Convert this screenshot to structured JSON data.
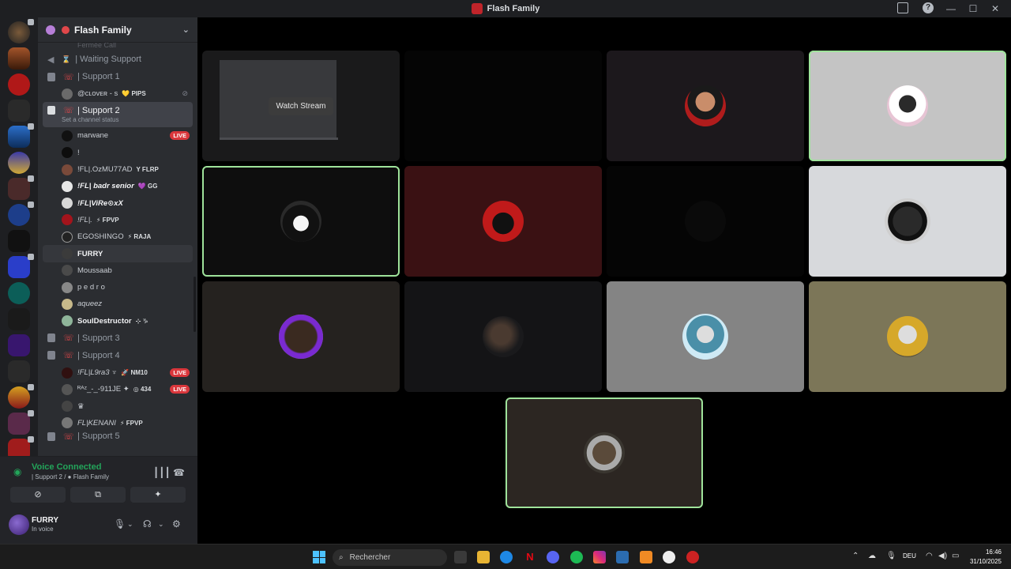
{
  "window": {
    "title": "Flash Family",
    "help_icon": "?",
    "controls": [
      "—",
      "☐",
      "✕"
    ]
  },
  "server": {
    "name": "Flash Family",
    "header_glyph": "❀",
    "chevron": "⌄",
    "cut_top_text": "Fermée Call"
  },
  "channels": {
    "waiting": "| Waiting Support",
    "waiting_glyph": "⌛",
    "support1": "| Support 1",
    "support2": "| Support 2",
    "support2_status": "Set a channel status",
    "support3": "| Support 3",
    "support4": "| Support 4",
    "support5": "| Support 5"
  },
  "members_support1": [
    {
      "name": "@ᴄʟᴏᴠᴇʀ - s",
      "tag": "💛 PIPS"
    }
  ],
  "members_support2": [
    {
      "name": "marwane",
      "live": "LIVE"
    },
    {
      "name": "!"
    },
    {
      "name": "!FL|.OzMU77AD",
      "tag": "Y FLRP"
    },
    {
      "name": "!FL| badr senior",
      "tag": "💜 GG"
    },
    {
      "name": "!FL|ViRe⊙xX"
    },
    {
      "name": "!FL|.",
      "tag": "⚡ FPVP"
    },
    {
      "name": "EGOSHINGO",
      "tag": "⚡ RAJA"
    },
    {
      "name": "FURRY"
    },
    {
      "name": "Moussaab"
    },
    {
      "name": "p e d r o"
    },
    {
      "name": "aqueez"
    },
    {
      "name": "SoulDestructor",
      "tag": "⊹ ♑"
    }
  ],
  "members_support4": [
    {
      "name": "!FL|L9ra3 ♆",
      "tag": "🚀 NM10",
      "live": "LIVE"
    },
    {
      "name": "ᴿᴬᶻ_-_-911JE ✦",
      "tag": "◎ 434",
      "live": "LIVE"
    },
    {
      "name": "♛"
    },
    {
      "name": "FL|KENANI",
      "tag": "⚡ FPVP"
    }
  ],
  "voice": {
    "status": "Voice Connected",
    "location": "| Support 2 / ● Flash Family",
    "buttons": [
      "⊘",
      "⧉",
      "✦"
    ]
  },
  "user": {
    "name": "FURRY",
    "status": "In voice"
  },
  "stage": {
    "watch_label": "Watch Stream"
  },
  "taskbar": {
    "search_placeholder": "Rechercher",
    "lang": "DEU",
    "time": "16:46",
    "date": "31/10/2025"
  },
  "colors": {
    "live": "#da373c",
    "voice_green": "#23a55a",
    "speaking_outline": "#9fe39b"
  }
}
